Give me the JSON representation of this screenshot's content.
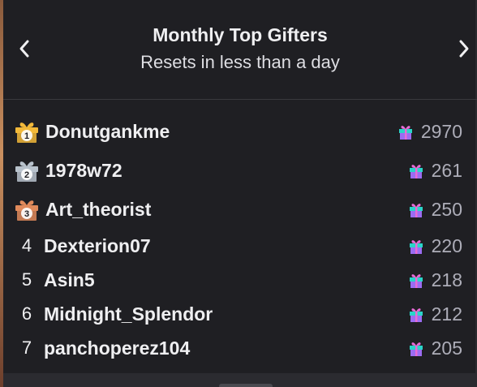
{
  "header": {
    "title": "Monthly Top Gifters",
    "subtitle": "Resets in less than a day",
    "prev_icon": "chevron-left-icon",
    "next_icon": "chevron-right-icon"
  },
  "colors": {
    "gold": "#f2b93a",
    "silver": "#b8c2cc",
    "bronze": "#e08a5b",
    "gift_teal": "#2ad4c8",
    "gift_pink": "#e86ad6",
    "gift_purple": "#9b6cf2"
  },
  "gifters": [
    {
      "rank": "1",
      "name": "Donutgankme",
      "amount": "2970",
      "badge": "gold"
    },
    {
      "rank": "2",
      "name": "1978w72",
      "amount": "261",
      "badge": "silver"
    },
    {
      "rank": "3",
      "name": "Art_theorist",
      "amount": "250",
      "badge": "bronze"
    },
    {
      "rank": "4",
      "name": "Dexterion07",
      "amount": "220"
    },
    {
      "rank": "5",
      "name": "Asin5",
      "amount": "218"
    },
    {
      "rank": "6",
      "name": "Midnight_Splendor",
      "amount": "212"
    },
    {
      "rank": "7",
      "name": "panchoperez104",
      "amount": "205"
    }
  ]
}
